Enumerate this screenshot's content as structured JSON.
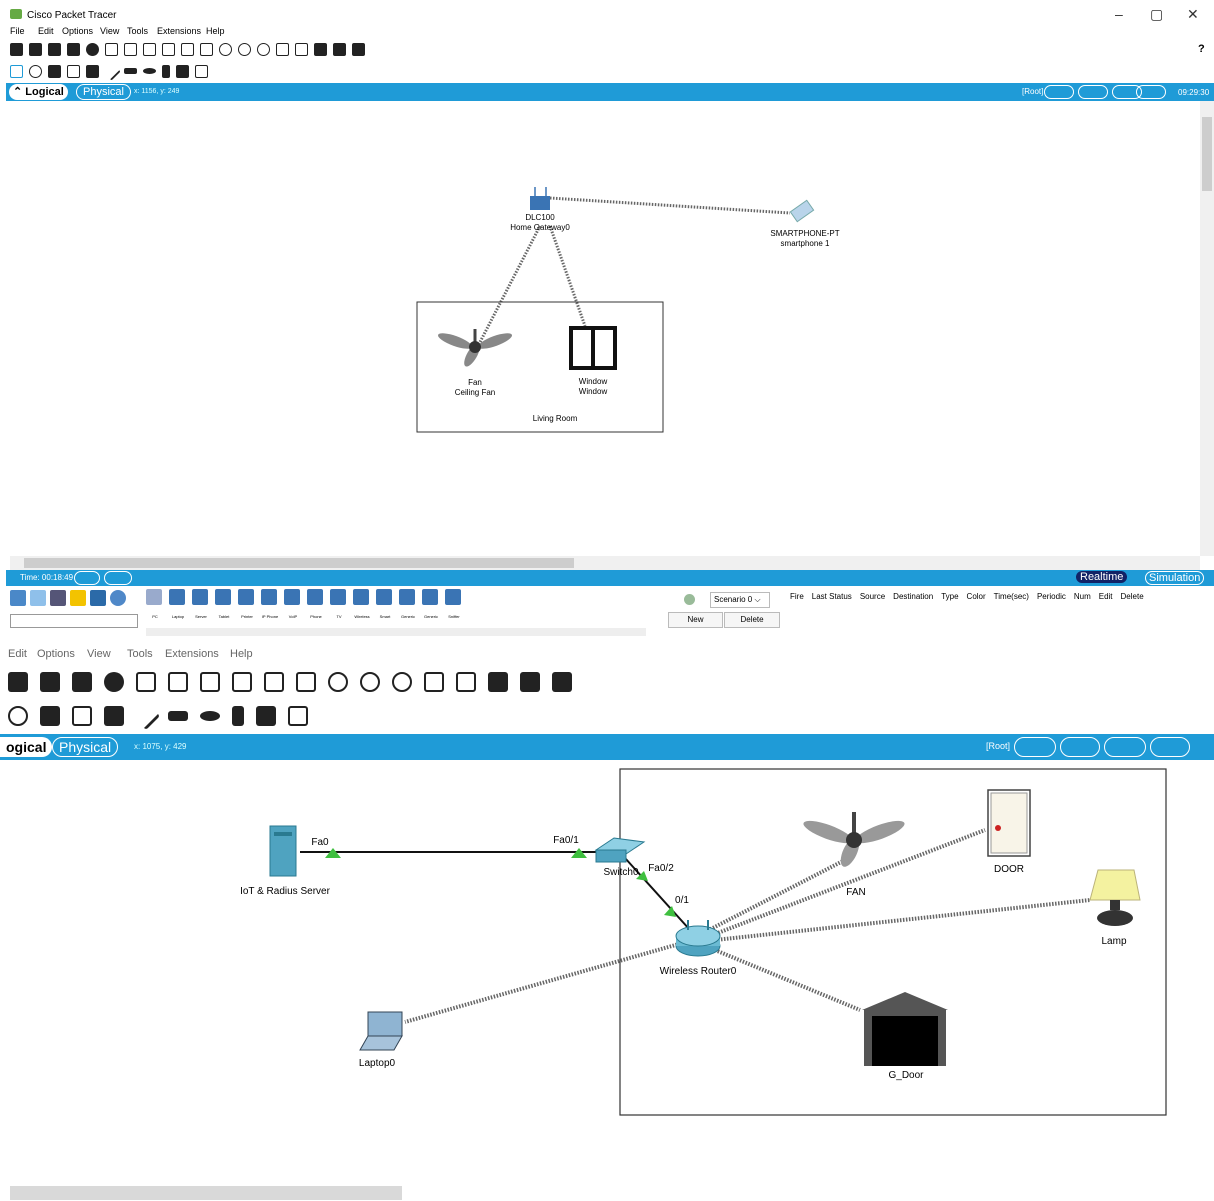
{
  "app": {
    "title": "Cisco Packet Tracer"
  },
  "menu": [
    "File",
    "Edit",
    "Options",
    "View",
    "Tools",
    "Extensions",
    "Help"
  ],
  "help_label": "?",
  "top": {
    "tab_logical": "Logical",
    "tab_physical": "Physical",
    "coords": "x: 1156, y: 249",
    "root_label": "[Root]",
    "clock": "09:29:30",
    "devices": {
      "gateway": {
        "model": "DLC100",
        "name": "Home Gateway0"
      },
      "smartphone": {
        "model": "SMARTPHONE-PT",
        "name": "smartphone 1"
      },
      "fan": {
        "model": "Fan",
        "name": "Ceiling Fan"
      },
      "window": {
        "model": "Window",
        "name": "Window"
      }
    },
    "room_label": "Living Room",
    "time_label": "Time: 00:18:49",
    "realtime": "Realtime",
    "simulation": "Simulation",
    "scenario": "Scenario 0",
    "new_btn": "New",
    "delete_btn": "Delete",
    "palette_labels": [
      "PC",
      "Laptop",
      "Server",
      "Tablet",
      "Printer",
      "IP Phone",
      "VoIP Device",
      "Phone",
      "TV",
      "Wireless Tablet",
      "Smart Device",
      "Generic Wireless",
      "Generic Wired",
      "Sniffer"
    ],
    "event_headers": [
      "Fire",
      "Last Status",
      "Source",
      "Destination",
      "Type",
      "Color",
      "Time(sec)",
      "Periodic",
      "Num",
      "Edit",
      "Delete"
    ]
  },
  "bottom": {
    "menu": [
      "Edit",
      "Options",
      "View",
      "Tools",
      "Extensions",
      "Help"
    ],
    "tab_logical": "ogical",
    "tab_physical": "Physical",
    "coords": "x: 1075, y: 429",
    "root_label": "[Root]",
    "devices": {
      "server": "IoT & Radius Server",
      "switch": "Switch0",
      "router": "Wireless Router0",
      "laptop": "Laptop0",
      "fan": "FAN",
      "door": "DOOR",
      "lamp": "Lamp",
      "gdoor": "G_Door"
    },
    "ports": {
      "fa0": "Fa0",
      "fa01": "Fa0/1",
      "fa02": "Fa0/2",
      "p01": "0/1"
    }
  },
  "colors": {
    "accent": "#1f9bd7",
    "link_green": "#3fbf3f"
  }
}
